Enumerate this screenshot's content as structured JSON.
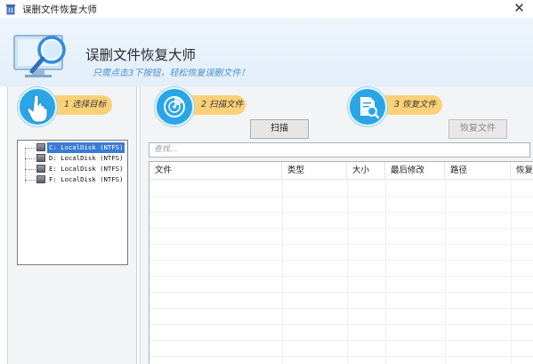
{
  "window": {
    "title": "误删文件恢复大师",
    "close_glyph": "✕",
    "app_icon": "recycle-bin-icon"
  },
  "banner": {
    "title": "误删文件恢复大师",
    "subtitle": "只需点击3下按钮，轻松恢复误删文件！",
    "logo_icon": "monitor-magnifier-icon"
  },
  "steps": [
    {
      "label": "1 选择目标",
      "icon": "pointing-hand-icon"
    },
    {
      "label": "2 扫描文件",
      "icon": "radar-scan-icon"
    },
    {
      "label": "3 恢复文件",
      "icon": "document-search-icon"
    }
  ],
  "buttons": {
    "scan": "扫描",
    "recover": "恢复文件"
  },
  "drives": [
    {
      "label": "C: LocalDisk (NTFS)",
      "selected": true
    },
    {
      "label": "D: LocalDisk (NTFS)",
      "selected": false
    },
    {
      "label": "E: LocalDisk (NTFS)",
      "selected": false
    },
    {
      "label": "F: LocalDisk (NTFS)",
      "selected": false
    }
  ],
  "search": {
    "placeholder": "查找..."
  },
  "table": {
    "columns": [
      "文件",
      "类型",
      "大小",
      "最后修改",
      "路径",
      "恢复"
    ],
    "rows": []
  },
  "colors": {
    "accent_blue": "#2aa6e8",
    "step_pill": "#fbd178",
    "subtitle": "#4a8fd0",
    "selection": "#3a7bd5"
  }
}
